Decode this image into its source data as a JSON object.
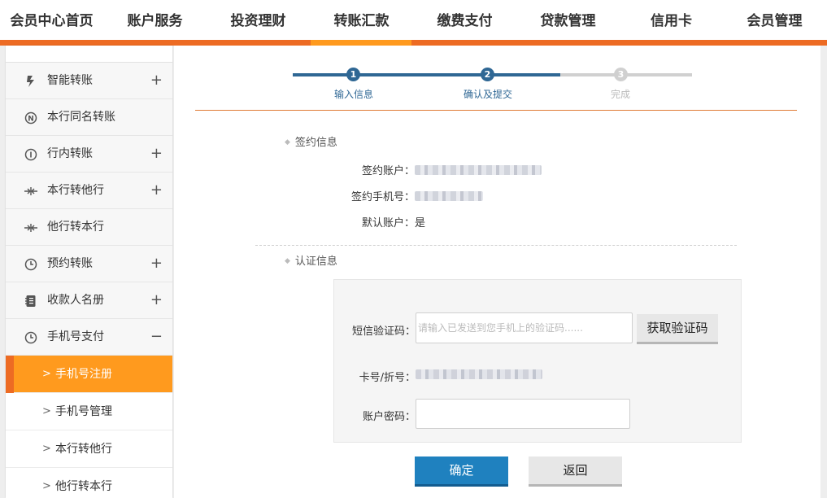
{
  "topnav": {
    "items": [
      "会员中心首页",
      "账户服务",
      "投资理财",
      "转账汇款",
      "缴费支付",
      "贷款管理",
      "信用卡",
      "会员管理"
    ],
    "active": "转账汇款"
  },
  "sidebar": {
    "items": [
      {
        "label": "智能转账",
        "icon": "smart-transfer-icon",
        "toggle": "+"
      },
      {
        "label": "本行同名转账",
        "icon": "n-circle-icon",
        "toggle": ""
      },
      {
        "label": "行内转账",
        "icon": "i-circle-icon",
        "toggle": "+"
      },
      {
        "label": "本行转他行",
        "icon": "transfer-arrows-icon",
        "toggle": "+"
      },
      {
        "label": "他行转本行",
        "icon": "transfer-arrows-icon",
        "toggle": ""
      },
      {
        "label": "预约转账",
        "icon": "clock-icon",
        "toggle": "+"
      },
      {
        "label": "收款人名册",
        "icon": "address-book-icon",
        "toggle": "+"
      },
      {
        "label": "手机号支付",
        "icon": "clock-icon",
        "toggle": "−"
      }
    ],
    "subitems": [
      {
        "label": "手机号注册",
        "active": true
      },
      {
        "label": "手机号管理",
        "active": false
      },
      {
        "label": "本行转他行",
        "active": false
      },
      {
        "label": "他行转本行",
        "active": false
      }
    ],
    "chevron": ">"
  },
  "stepper": {
    "steps": [
      {
        "num": "1",
        "label": "输入信息",
        "state": "done"
      },
      {
        "num": "2",
        "label": "确认及提交",
        "state": "current"
      },
      {
        "num": "3",
        "label": "完成",
        "state": "pending"
      }
    ]
  },
  "signing": {
    "title": "签约信息",
    "account_label": "签约账户：",
    "phone_label": "签约手机号：",
    "default_label": "默认账户：",
    "default_value": "是"
  },
  "auth": {
    "title": "认证信息",
    "sms_label": "短信验证码：",
    "sms_placeholder": "请输入已发送到您手机上的验证码......",
    "get_code_label": "获取验证码",
    "card_label": "卡号/折号：",
    "password_label": "账户密码："
  },
  "actions": {
    "confirm_label": "确定",
    "back_label": "返回"
  }
}
